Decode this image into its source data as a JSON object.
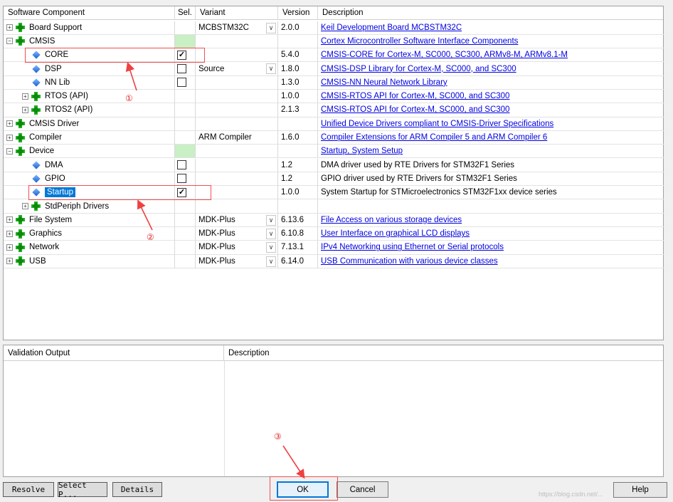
{
  "columns": {
    "component": "Software Component",
    "sel": "Sel.",
    "variant": "Variant",
    "version": "Version",
    "description": "Description"
  },
  "rows": [
    {
      "name": "Board Support",
      "indent": 0,
      "expander": "+",
      "icon": "green-cross-diamond-icon",
      "variant": "MCBSTM32C",
      "combo": true,
      "version": "2.0.0",
      "description": "Keil Development Board MCBSTM32C",
      "link": true
    },
    {
      "name": "CMSIS",
      "indent": 0,
      "expander": "-",
      "icon": "green-cross-diamond-icon",
      "sel_green": true,
      "variant": "",
      "version": "",
      "description": "Cortex Microcontroller Software Interface Components",
      "link": true
    },
    {
      "name": "CORE",
      "indent": 1,
      "expander": "",
      "icon": "blue-gem-icon",
      "checkbox": true,
      "checked": true,
      "variant": "",
      "version": "5.4.0",
      "description": "CMSIS-CORE for Cortex-M, SC000, SC300, ARMv8-M, ARMv8.1-M",
      "link": true
    },
    {
      "name": "DSP",
      "indent": 1,
      "expander": "",
      "icon": "blue-gem-icon",
      "checkbox": true,
      "checked": false,
      "variant": "Source",
      "combo": true,
      "version": "1.8.0",
      "description": "CMSIS-DSP Library for Cortex-M, SC000, and SC300",
      "link": true
    },
    {
      "name": "NN Lib",
      "indent": 1,
      "expander": "",
      "icon": "blue-gem-icon",
      "checkbox": true,
      "checked": false,
      "variant": "",
      "version": "1.3.0",
      "description": "CMSIS-NN Neural Network Library",
      "link": true
    },
    {
      "name": "RTOS (API)",
      "indent": 1,
      "expander": "+",
      "icon": "green-cross-diamond-icon",
      "variant": "",
      "version": "1.0.0",
      "description": "CMSIS-RTOS API for Cortex-M, SC000, and SC300",
      "link": true
    },
    {
      "name": "RTOS2 (API)",
      "indent": 1,
      "expander": "+",
      "icon": "green-cross-diamond-icon",
      "variant": "",
      "version": "2.1.3",
      "description": "CMSIS-RTOS API for Cortex-M, SC000, and SC300",
      "link": true
    },
    {
      "name": "CMSIS Driver",
      "indent": 0,
      "expander": "+",
      "icon": "green-cross-diamond-icon",
      "variant": "",
      "version": "",
      "description": "Unified Device Drivers compliant to CMSIS-Driver Specifications",
      "link": true
    },
    {
      "name": "Compiler",
      "indent": 0,
      "expander": "+",
      "icon": "green-cross-diamond-icon",
      "variant": "ARM Compiler",
      "version": "1.6.0",
      "description": "Compiler Extensions for ARM Compiler 5 and ARM Compiler 6",
      "link": true
    },
    {
      "name": "Device",
      "indent": 0,
      "expander": "-",
      "icon": "green-cross-diamond-icon",
      "sel_green": true,
      "variant": "",
      "version": "",
      "description": "Startup, System Setup",
      "link": true
    },
    {
      "name": "DMA",
      "indent": 1,
      "expander": "",
      "icon": "blue-gem-icon",
      "checkbox": true,
      "checked": false,
      "variant": "",
      "version": "1.2",
      "description": "DMA driver used by RTE Drivers for STM32F1 Series",
      "link": false
    },
    {
      "name": "GPIO",
      "indent": 1,
      "expander": "",
      "icon": "blue-gem-icon",
      "checkbox": true,
      "checked": false,
      "variant": "",
      "version": "1.2",
      "description": "GPIO driver used by RTE Drivers for STM32F1 Series",
      "link": false
    },
    {
      "name": "Startup",
      "indent": 1,
      "expander": "",
      "icon": "blue-gem-icon",
      "checkbox": true,
      "checked": true,
      "selected": true,
      "variant": "",
      "version": "1.0.0",
      "description": "System Startup for STMicroelectronics STM32F1xx device series",
      "link": false
    },
    {
      "name": "StdPeriph Drivers",
      "indent": 1,
      "expander": "+",
      "icon": "green-cross-diamond-icon",
      "variant": "",
      "version": "",
      "description": "",
      "link": false
    },
    {
      "name": "File System",
      "indent": 0,
      "expander": "+",
      "icon": "green-cross-diamond-icon",
      "variant": "MDK-Plus",
      "combo": true,
      "version": "6.13.6",
      "description": "File Access on various storage devices",
      "link": true
    },
    {
      "name": "Graphics",
      "indent": 0,
      "expander": "+",
      "icon": "green-cross-diamond-icon",
      "variant": "MDK-Plus",
      "combo": true,
      "version": "6.10.8",
      "description": "User Interface on graphical LCD displays",
      "link": true
    },
    {
      "name": "Network",
      "indent": 0,
      "expander": "+",
      "icon": "green-cross-diamond-icon",
      "variant": "MDK-Plus",
      "combo": true,
      "version": "7.13.1",
      "description": "IPv4 Networking using Ethernet or Serial protocols",
      "link": true
    },
    {
      "name": "USB",
      "indent": 0,
      "expander": "+",
      "icon": "green-cross-diamond-icon",
      "variant": "MDK-Plus",
      "combo": true,
      "version": "6.14.0",
      "description": "USB Communication with various device classes",
      "link": true
    }
  ],
  "validation": {
    "output_header": "Validation Output",
    "description_header": "Description"
  },
  "buttons": {
    "resolve": "Resolve",
    "select_packs": "Select P...",
    "details": "Details",
    "ok": "OK",
    "cancel": "Cancel",
    "help": "Help"
  },
  "annotations": {
    "marker1": "①",
    "marker2": "②",
    "marker3": "③"
  },
  "watermark": "https://blog.csdn.net/...",
  "colors": {
    "link": "#0000e0",
    "selection": "#0078d7",
    "sel_green": "#c9f0c5",
    "annotation_red": "#f05050"
  }
}
